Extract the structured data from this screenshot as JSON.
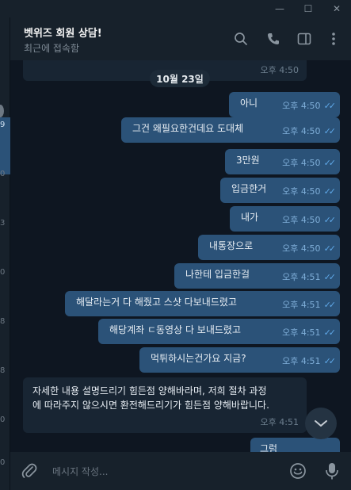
{
  "window": {
    "minimize": "—",
    "maximize": "☐",
    "close": "✕"
  },
  "left_strip": {
    "marks": [
      "9",
      "0",
      "3",
      "0",
      "8",
      "8",
      "0",
      "0"
    ]
  },
  "header": {
    "title": "벳위즈 회원 상담!",
    "status": "최근에 접속함"
  },
  "date_separator": "10월 23일",
  "messages": {
    "partial_top": {
      "time": "오후 4:50"
    },
    "outgoing": [
      {
        "text": "아니",
        "time": "오후 4:50"
      },
      {
        "text": "그건 왜필요한건데요 도대체",
        "time": "오후 4:50"
      },
      {
        "text": "3만원",
        "time": "오후 4:50"
      },
      {
        "text": "입금한거",
        "time": "오후 4:50"
      },
      {
        "text": "내가",
        "time": "오후 4:50"
      },
      {
        "text": "내통장으로",
        "time": "오후 4:50"
      },
      {
        "text": "나한테 입금한걸",
        "time": "오후 4:51"
      },
      {
        "text": "해달라는거 다 해줬고 스샷 다보내드렸고",
        "time": "오후 4:51"
      },
      {
        "text": "해당계좌 ㄷ동영상 다 보내드렸고",
        "time": "오후 4:51"
      },
      {
        "text": "먹튀하시는건가요 지금?",
        "time": "오후 4:51"
      }
    ],
    "incoming": {
      "text": "자세한 내용 설명드리기 힘든점 양해바라며, 저희 절차 과정에 따라주지 않으시면 환전해드리기가 힘든점 양해바랍니다.",
      "time": "오후 4:51"
    },
    "partial_bottom": {
      "text": "그럼"
    }
  },
  "composer": {
    "placeholder": "메시지 작성..."
  },
  "colors": {
    "background": "#0e1621",
    "panel": "#17212b",
    "outgoing_bubble": "#2b5278",
    "incoming_bubble": "#182533",
    "read_ticks": "#5fa8e8"
  },
  "icons": {
    "search": "search-icon",
    "call": "phone-icon",
    "sidebar": "sidebar-toggle-icon",
    "more": "more-vertical-icon",
    "attach": "paperclip-icon",
    "emoji": "emoji-icon",
    "voice": "microphone-icon",
    "scroll_down": "chevron-down-icon"
  }
}
